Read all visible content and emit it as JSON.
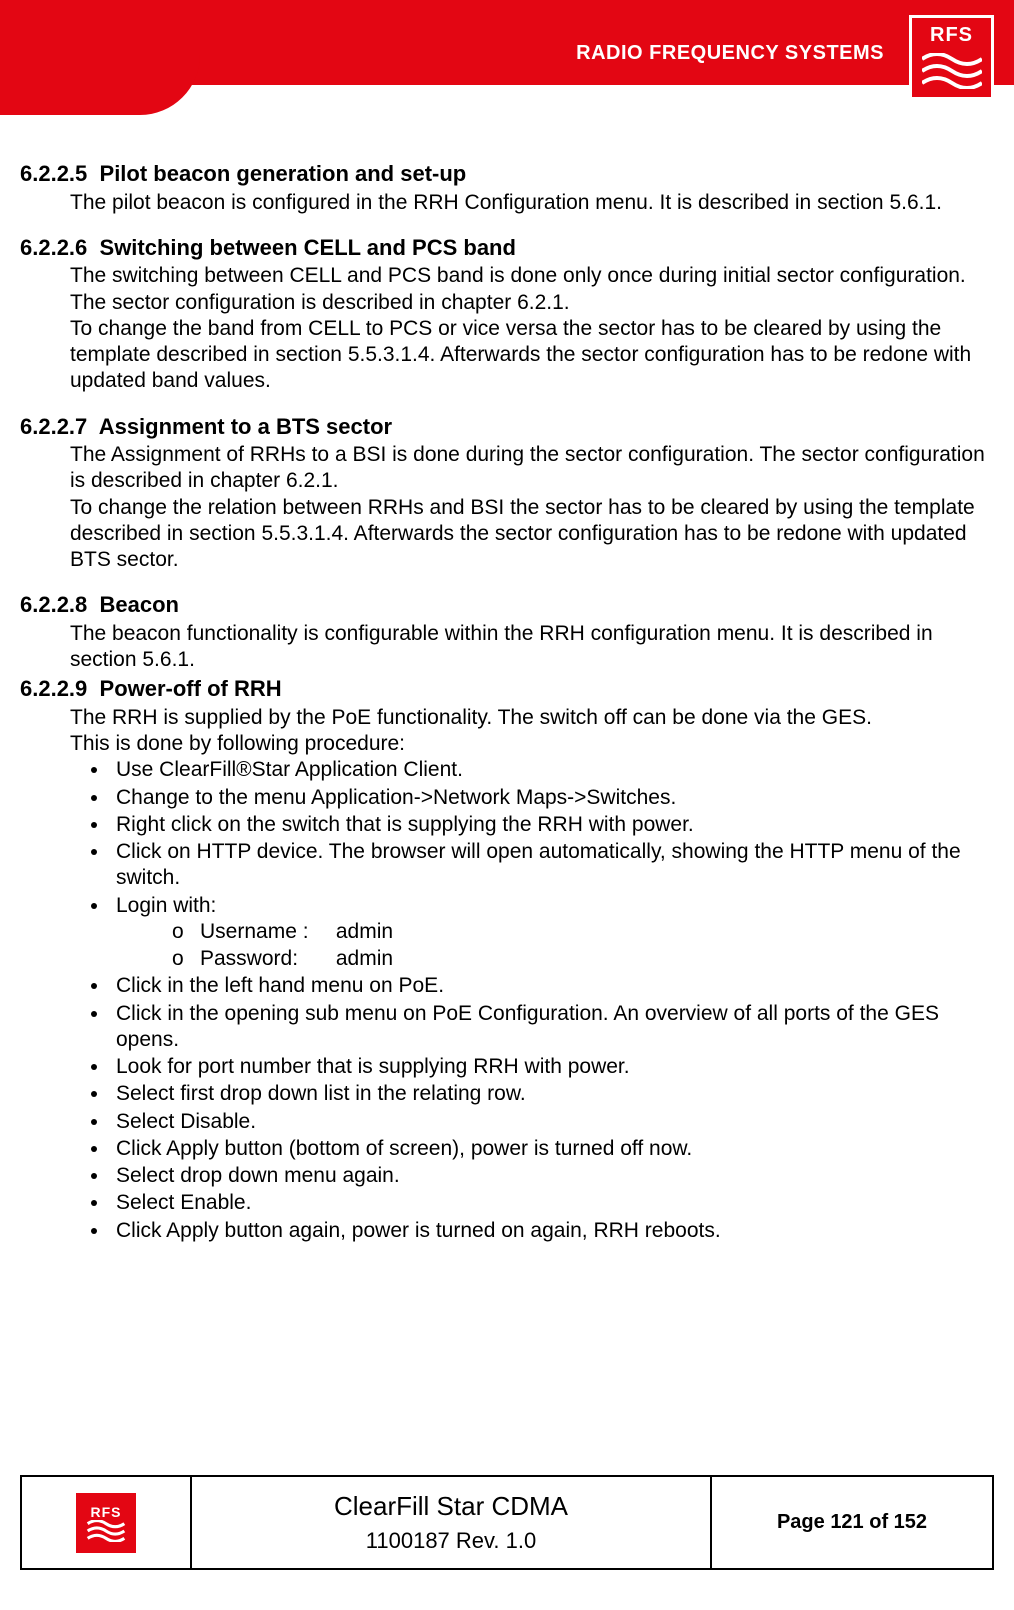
{
  "header": {
    "brand_text": "RADIO FREQUENCY SYSTEMS",
    "logo_text": "RFS"
  },
  "sections": {
    "s1": {
      "num": "6.2.2.5",
      "title": "Pilot beacon generation and set-up",
      "body": "The pilot beacon is configured in the RRH Configuration menu. It is described in section 5.6.1."
    },
    "s2": {
      "num": "6.2.2.6",
      "title": "Switching between CELL and PCS band",
      "body1": "The switching between CELL and PCS band is done only once during initial sector configuration. The sector configuration is described in chapter 6.2.1.",
      "body2": "To change the band from CELL to PCS or vice versa the sector has to be cleared by using the template described in section 5.5.3.1.4. Afterwards the sector configuration has to be redone with updated band values."
    },
    "s3": {
      "num": "6.2.2.7",
      "title": "Assignment to a BTS sector",
      "body1": "The Assignment of RRHs to a BSI is done during the sector configuration. The sector configuration is described in chapter 6.2.1.",
      "body2": "To change the relation between RRHs and BSI the sector has to be cleared by using the template described in section 5.5.3.1.4. Afterwards the sector configuration has to be redone with updated BTS sector."
    },
    "s4": {
      "num": "6.2.2.8",
      "title": "Beacon",
      "body": "The beacon functionality is configurable within the RRH configuration menu. It is described in section 5.6.1."
    },
    "s5": {
      "num": "6.2.2.9",
      "title": "Power-off of RRH",
      "body1": "The RRH is supplied by the PoE functionality. The switch off can be done via the GES.",
      "body2": "This is done by following procedure:",
      "bullets": {
        "b1": "Use ClearFill®Star Application Client.",
        "b2": "Change to the menu Application->Network Maps->Switches.",
        "b3": "Right click on the switch that is supplying the RRH with power.",
        "b4": "Click on HTTP device. The browser will open automatically, showing the HTTP menu of the switch.",
        "b5": "Login with:",
        "b5_sub": {
          "u_label": "Username :",
          "u_val": "admin",
          "p_label": "Password:",
          "p_val": "admin"
        },
        "b6": "Click in the left hand menu on PoE.",
        "b7": "Click in the opening sub menu on PoE Configuration. An overview of all ports of the GES opens.",
        "b8": "Look for port number that is supplying RRH with power.",
        "b9": "Select first drop down list in the relating row.",
        "b10": "Select Disable.",
        "b11": "Click Apply button (bottom of screen), power is turned off now.",
        "b12": "Select drop down menu again.",
        "b13": "Select Enable.",
        "b14": "Click Apply button again, power is turned on again, RRH reboots."
      }
    }
  },
  "footer": {
    "logo_text": "RFS",
    "doc_title": "ClearFill Star CDMA",
    "doc_rev": "1100187 Rev. 1.0",
    "page": "Page 121 of 152"
  }
}
